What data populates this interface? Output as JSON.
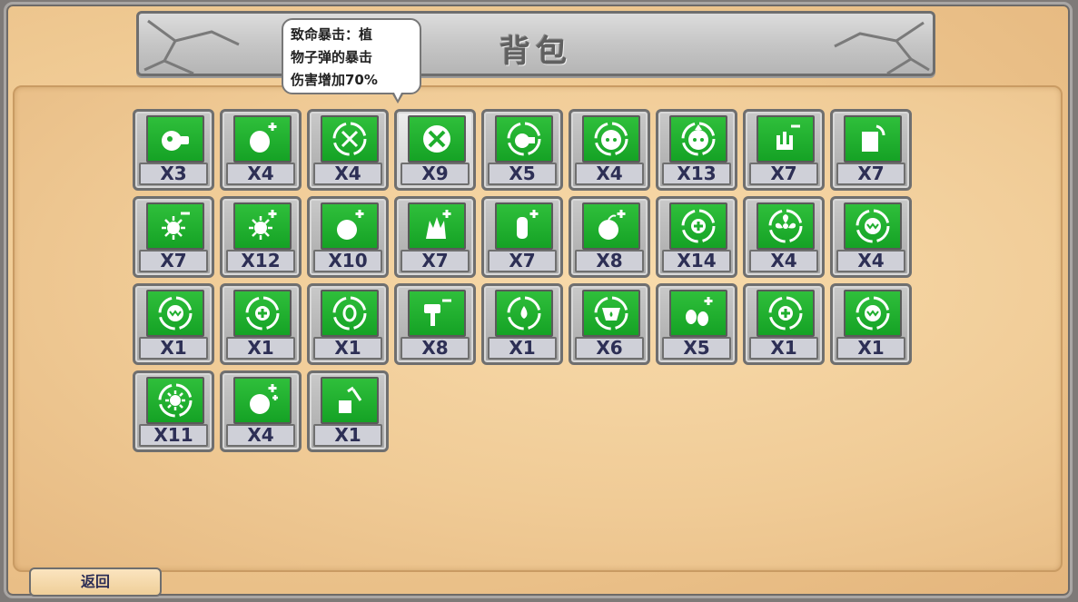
{
  "header": {
    "title": "背包"
  },
  "tooltip": {
    "lines": [
      "致命暴击：植",
      "物子弹的暴击",
      "伤害增加70%"
    ]
  },
  "footer": {
    "back_label": "返回"
  },
  "colors": {
    "icon_green": "#1fae2e",
    "count_text": "#2d2f55",
    "parchment": "#f0cb96",
    "stone": "#c6c6c6"
  },
  "inventory": [
    {
      "icon": "peashooter-icon",
      "count": "X3"
    },
    {
      "icon": "seed-plus-icon",
      "count": "X4"
    },
    {
      "icon": "crosshair-icon",
      "count": "X4"
    },
    {
      "icon": "critical-hit-icon",
      "count": "X9"
    },
    {
      "icon": "alien-peashooter-icon",
      "count": "X5"
    },
    {
      "icon": "face-ring-icon",
      "count": "X4"
    },
    {
      "icon": "face-leaf-icon",
      "count": "X13"
    },
    {
      "icon": "hand-minus-icon",
      "count": "X7"
    },
    {
      "icon": "card-refresh-icon",
      "count": "X7"
    },
    {
      "icon": "sun-minus-icon",
      "count": "X7"
    },
    {
      "icon": "sun-plus-icon",
      "count": "X12"
    },
    {
      "icon": "bomb-plus-icon",
      "count": "X10"
    },
    {
      "icon": "spiky-plus-icon",
      "count": "X7"
    },
    {
      "icon": "cactus-plus-icon",
      "count": "X7"
    },
    {
      "icon": "apple-plus-icon",
      "count": "X8"
    },
    {
      "icon": "health-ring-icon",
      "count": "X14"
    },
    {
      "icon": "fan-icon",
      "count": "X4"
    },
    {
      "icon": "chomper-icon",
      "count": "X4"
    },
    {
      "icon": "chomper-ring-icon",
      "count": "X1"
    },
    {
      "icon": "heal-ring-icon",
      "count": "X1"
    },
    {
      "icon": "zero-ring-icon",
      "count": "X1"
    },
    {
      "icon": "hammer-minus-icon",
      "count": "X8"
    },
    {
      "icon": "drop-ring-icon",
      "count": "X1"
    },
    {
      "icon": "jaw-drop-icon",
      "count": "X6"
    },
    {
      "icon": "seeds-plus-icon",
      "count": "X5"
    },
    {
      "icon": "heal-refresh-icon",
      "count": "X1"
    },
    {
      "icon": "fang-ring-icon",
      "count": "X1"
    },
    {
      "icon": "sunflower-ring-icon",
      "count": "X11"
    },
    {
      "icon": "apple-double-plus-icon",
      "count": "X4"
    },
    {
      "icon": "shovel-plant-icon",
      "count": "X1"
    }
  ]
}
